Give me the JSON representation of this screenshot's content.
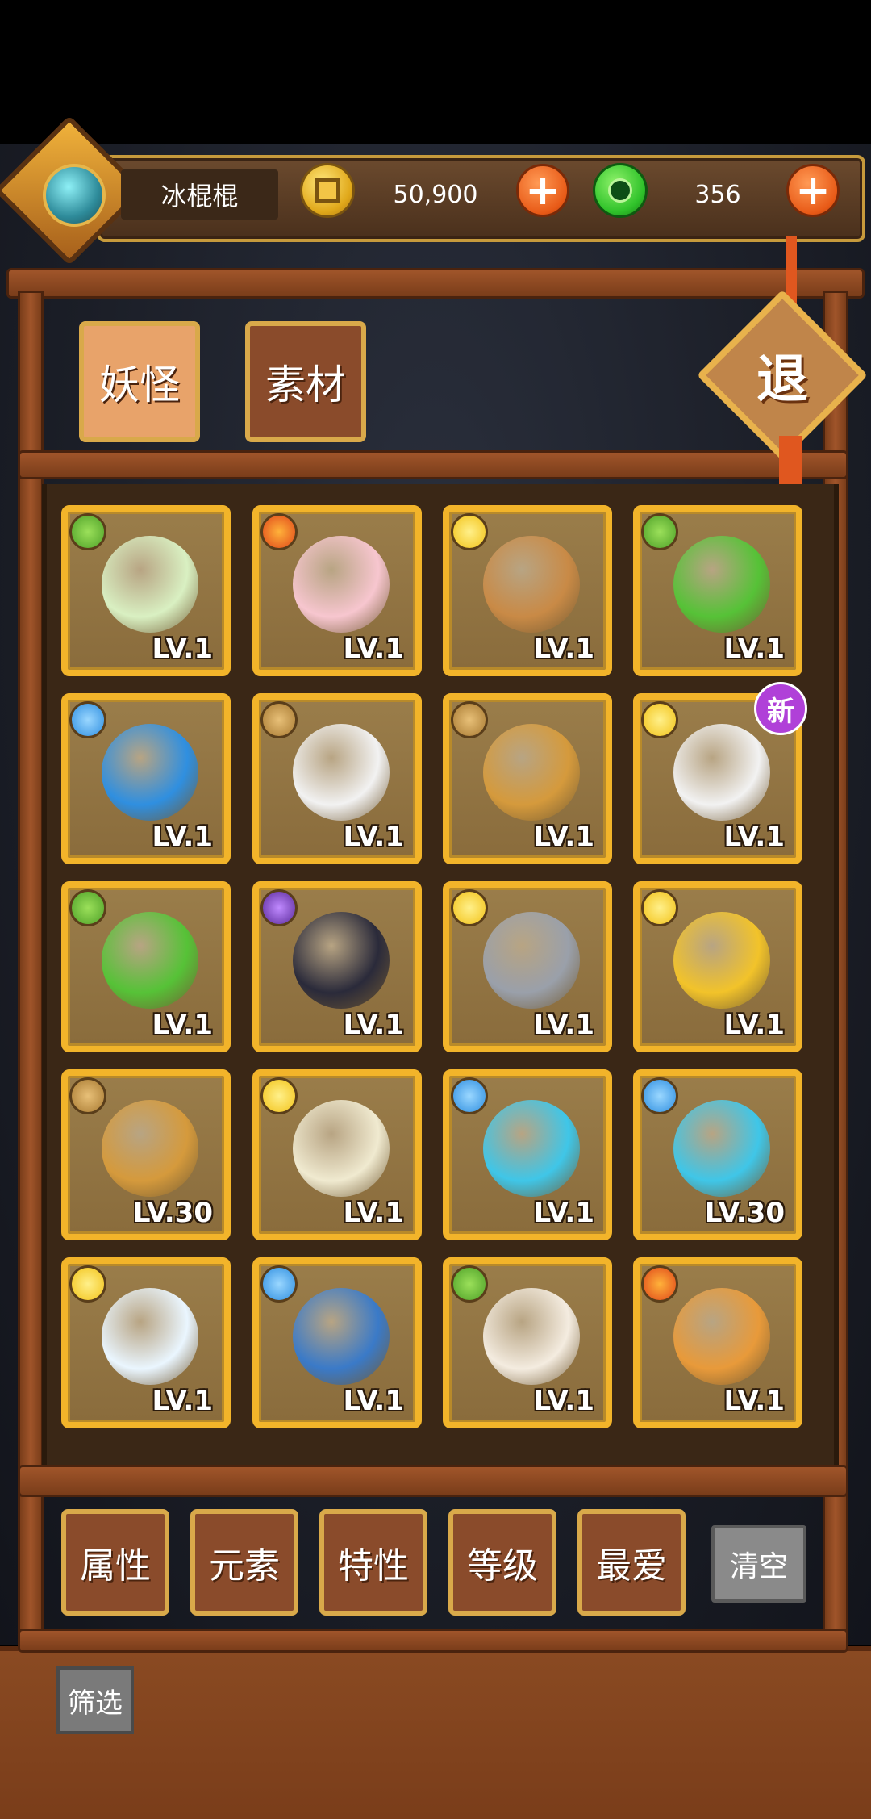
{
  "player": {
    "name": "冰棍棍"
  },
  "currency": {
    "coins": "50,900",
    "gems": "356",
    "plus": "+"
  },
  "tabs": [
    {
      "label": "妖怪",
      "active": true
    },
    {
      "label": "素材",
      "active": false
    }
  ],
  "exit_label": "退",
  "grid": [
    {
      "element": "leaf",
      "level": "LV.1",
      "color": "#d9f0c2"
    },
    {
      "element": "fire",
      "level": "LV.1",
      "color": "#f7c6cf"
    },
    {
      "element": "sun",
      "level": "LV.1",
      "color": "#c98a46"
    },
    {
      "element": "leaf",
      "level": "LV.1",
      "color": "#56c237"
    },
    {
      "element": "water",
      "level": "LV.1",
      "color": "#2f8fe0"
    },
    {
      "element": "mountain",
      "level": "LV.1",
      "color": "#f2f2f2"
    },
    {
      "element": "mountain",
      "level": "LV.1",
      "color": "#d59a3c"
    },
    {
      "element": "sun",
      "level": "LV.1",
      "color": "#f2f2f2",
      "new": "新"
    },
    {
      "element": "leaf",
      "level": "LV.1",
      "color": "#56c237"
    },
    {
      "element": "moon",
      "level": "LV.1",
      "color": "#2a2a3a"
    },
    {
      "element": "sun",
      "level": "LV.1",
      "color": "#9aa0aa"
    },
    {
      "element": "sun",
      "level": "LV.1",
      "color": "#f2c32a"
    },
    {
      "element": "mountain",
      "level": "LV.30",
      "color": "#d59a3c"
    },
    {
      "element": "sun",
      "level": "LV.1",
      "color": "#f0ead0"
    },
    {
      "element": "water",
      "level": "LV.1",
      "color": "#3fc6e8"
    },
    {
      "element": "water",
      "level": "LV.30",
      "color": "#3fc6e8"
    },
    {
      "element": "sun",
      "level": "LV.1",
      "color": "#eaf6ff"
    },
    {
      "element": "water",
      "level": "LV.1",
      "color": "#3a7ac8"
    },
    {
      "element": "leaf",
      "level": "LV.1",
      "color": "#f4ece0"
    },
    {
      "element": "fire",
      "level": "LV.1",
      "color": "#e89a3a"
    }
  ],
  "filters": [
    "属性",
    "元素",
    "特性",
    "等级",
    "最爱"
  ],
  "clear_label": "清空",
  "screen_label": "筛选"
}
